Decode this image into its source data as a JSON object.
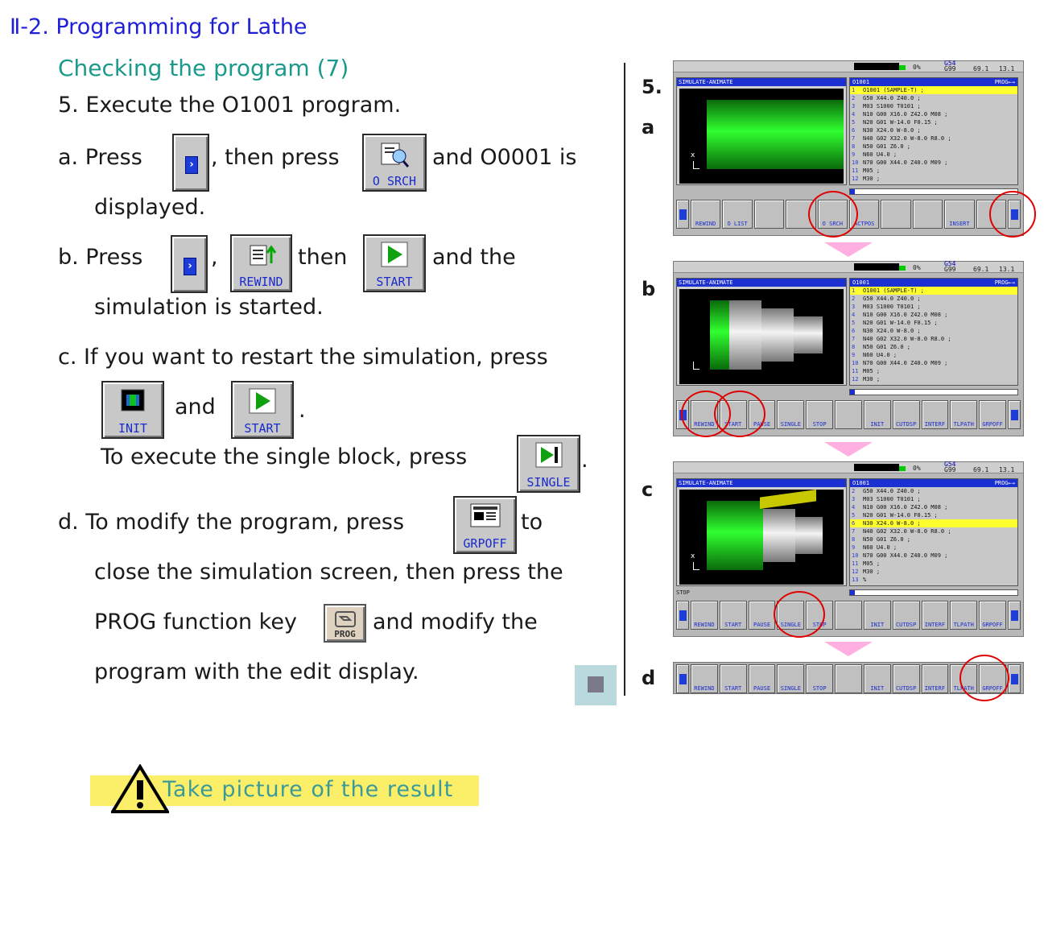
{
  "header": {
    "title": "Ⅱ-2. Programming for Lathe",
    "subtitle": "Checking the program (7)"
  },
  "steps": {
    "s5": "5.  Execute the O1001 program.",
    "a_press": "a.  Press",
    "a_then": ", then press",
    "a_and": "and O0001 is",
    "a_disp": "displayed.",
    "b_press": "b.  Press",
    "b_comma": ",",
    "b_then": "then",
    "b_and": "and the",
    "b_sim": "simulation is started.",
    "c_if": "c.  If you want to restart the simulation, press",
    "c_and": "and",
    "c_dot": ".",
    "c_single": "To execute the single block, press",
    "c_dot2": ".",
    "d_mod": "d.  To modify the program, press",
    "d_to": "to",
    "d_close": "close the simulation screen, then press the",
    "d_prog": "PROG function key",
    "d_andmod": "and modify the",
    "d_edit": "program with the edit display."
  },
  "keys": {
    "osrch": "O SRCH",
    "rewind": "REWIND",
    "start": "START",
    "init": "INIT",
    "single": "SINGLE",
    "grpoff": "GRPOFF",
    "prog": "PROG"
  },
  "labels": {
    "l5": "5.",
    "la": "a",
    "lb": "b",
    "lc": "c",
    "ld": "d"
  },
  "screens": {
    "status": {
      "pct": "0%",
      "g54": "G54",
      "g99": "G99",
      "v1": "69.1",
      "v2": "13.1"
    },
    "sim_title": "SIMULATE-ANIMATE",
    "prog_title": "O1001",
    "prog_mode": "PROG←→",
    "lines_a": [
      {
        "n": "1",
        "t": "O1001 (SAMPLE-T) ;",
        "hl": true
      },
      {
        "n": "2",
        "t": "G50 X44.0 Z40.0 ;"
      },
      {
        "n": "3",
        "t": "M03 S1000 T0101 ;"
      },
      {
        "n": "4",
        "t": "N10 G00 X16.0 Z42.0 M08 ;"
      },
      {
        "n": "5",
        "t": "N20 G01 W-14.0 F0.15 ;"
      },
      {
        "n": "6",
        "t": "N30 X24.0 W-8.0 ;"
      },
      {
        "n": "7",
        "t": "N40 G02 X32.0 W-8.0 R8.0 ;"
      },
      {
        "n": "8",
        "t": "N50 G01 Z6.0 ;"
      },
      {
        "n": "9",
        "t": "N60 U4.0 ;"
      },
      {
        "n": "10",
        "t": "N70 G00 X44.0 Z40.0 M09 ;"
      },
      {
        "n": "11",
        "t": "M05 ;"
      },
      {
        "n": "12",
        "t": "M30 ;"
      }
    ],
    "lines_c": [
      {
        "n": "2",
        "t": "G50 X44.0 Z40.0 ;"
      },
      {
        "n": "3",
        "t": "M03 S1000 T0101 ;"
      },
      {
        "n": "4",
        "t": "N10 G00 X16.0 Z42.0 M08 ;"
      },
      {
        "n": "5",
        "t": "N20 G01 W-14.0 F0.15 ;"
      },
      {
        "n": "6",
        "t": "N30 X24.0 W-8.0 ;",
        "hl": true
      },
      {
        "n": "7",
        "t": "N40 G02 X32.0 W-8.0 R8.0 ;"
      },
      {
        "n": "8",
        "t": "N50 G01 Z6.0 ;"
      },
      {
        "n": "9",
        "t": "N60 U4.0 ;"
      },
      {
        "n": "10",
        "t": "N70 G00 X44.0 Z40.0 M09 ;"
      },
      {
        "n": "11",
        "t": "M05 ;"
      },
      {
        "n": "12",
        "t": "M30 ;"
      },
      {
        "n": "13",
        "t": "%"
      }
    ],
    "sk_a": [
      "REWIND",
      "O LIST",
      "",
      "",
      "O SRCH",
      "ACTPOS",
      "",
      "",
      "INSERT",
      ""
    ],
    "sk_b": [
      "REWIND",
      "START",
      "PAUSE",
      "SINGLE",
      "STOP",
      "",
      "INIT",
      "CUTDSP",
      "INTERF",
      "TLPATH",
      "GRPOFF"
    ],
    "stop_label": "STOP"
  },
  "note": "Take picture of the result"
}
